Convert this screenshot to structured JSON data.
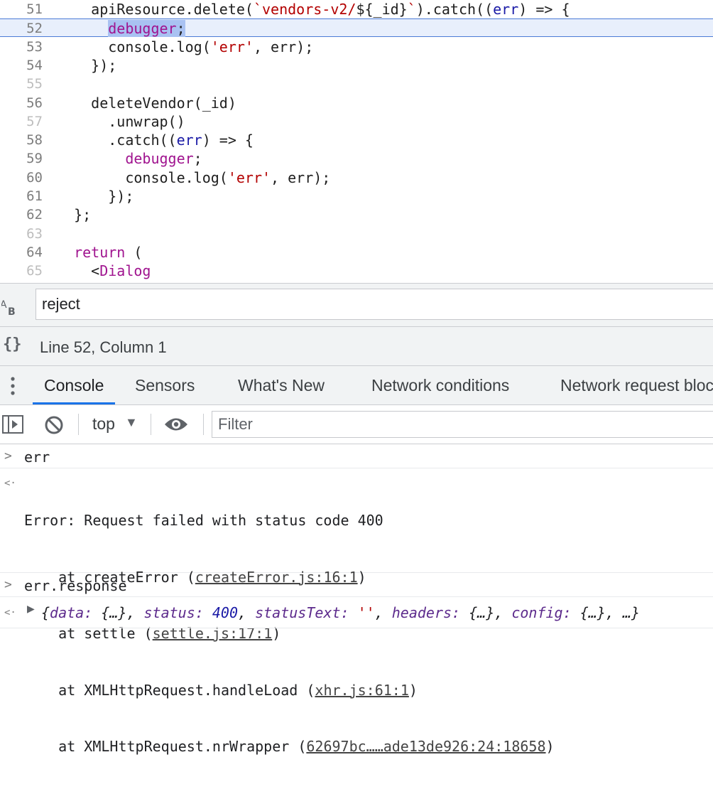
{
  "editor": {
    "lines": [
      {
        "num": "51",
        "tokens": [
          [
            "",
            "    apiResource.delete("
          ],
          [
            "str",
            "`vendors-v2/"
          ],
          [
            "",
            "${_id}"
          ],
          [
            "str",
            "`"
          ],
          [
            "",
            ").catch(("
          ],
          [
            "var",
            "err"
          ],
          [
            "",
            ") => {"
          ]
        ]
      },
      {
        "num": "52",
        "tokens": [
          [
            "",
            "      "
          ],
          [
            "kw sel",
            "debugger"
          ],
          [
            "sel",
            ";"
          ]
        ],
        "current": true
      },
      {
        "num": "53",
        "tokens": [
          [
            "",
            "      console.log("
          ],
          [
            "str",
            "'err'"
          ],
          [
            "",
            ", err);"
          ]
        ]
      },
      {
        "num": "54",
        "tokens": [
          [
            "",
            "    });"
          ]
        ]
      },
      {
        "num": "55",
        "tokens": [],
        "dim": true
      },
      {
        "num": "56",
        "tokens": [
          [
            "",
            "    deleteVendor(_id)"
          ]
        ]
      },
      {
        "num": "57",
        "tokens": [
          [
            "",
            "      .unwrap()"
          ]
        ],
        "dim": true
      },
      {
        "num": "58",
        "tokens": [
          [
            "",
            "      .catch(("
          ],
          [
            "var",
            "err"
          ],
          [
            "",
            ") => {"
          ]
        ]
      },
      {
        "num": "59",
        "tokens": [
          [
            "",
            "        "
          ],
          [
            "kw",
            "debugger"
          ],
          [
            "",
            ";"
          ]
        ]
      },
      {
        "num": "60",
        "tokens": [
          [
            "",
            "        console.log("
          ],
          [
            "str",
            "'err'"
          ],
          [
            "",
            ", err);"
          ]
        ]
      },
      {
        "num": "61",
        "tokens": [
          [
            "",
            "      });"
          ]
        ]
      },
      {
        "num": "62",
        "tokens": [
          [
            "",
            "  };"
          ]
        ]
      },
      {
        "num": "63",
        "tokens": [],
        "dim": true
      },
      {
        "num": "64",
        "tokens": [
          [
            "",
            "  "
          ],
          [
            "kw",
            "return"
          ],
          [
            "",
            " ("
          ]
        ]
      },
      {
        "num": "65",
        "tokens": [
          [
            "",
            "    <"
          ],
          [
            "kw",
            "Dialog"
          ]
        ],
        "dim": true
      }
    ]
  },
  "search": {
    "value": "reject",
    "icon": "regex-icon"
  },
  "status": {
    "position": "Line 52, Column 1",
    "icon": "pretty-print-icon"
  },
  "drawer": {
    "tabs": [
      {
        "label": "Console",
        "active": true
      },
      {
        "label": "Sensors"
      },
      {
        "label": "What's New"
      },
      {
        "label": "Network conditions"
      },
      {
        "label": "Network request blocking"
      }
    ]
  },
  "toolbar": {
    "context": "top",
    "context_arrow": "▼",
    "filter_placeholder": "Filter"
  },
  "console": {
    "input_prompt": ">",
    "output_prompt": "<·",
    "cmd1": "err",
    "error_message": "Error: Request failed with status code 400",
    "stack": [
      {
        "prefix": "    at createError (",
        "link": "createError.js:16:1",
        "suffix": ")"
      },
      {
        "prefix": "    at settle (",
        "link": "settle.js:17:1",
        "suffix": ")"
      },
      {
        "prefix": "    at XMLHttpRequest.handleLoad (",
        "link": "xhr.js:61:1",
        "suffix": ")"
      },
      {
        "prefix": "    at XMLHttpRequest.nrWrapper (",
        "link": "62697bc……ade13de926:24:18658",
        "suffix": ")"
      }
    ],
    "cmd2": "err.response",
    "object_preview": {
      "open": "{",
      "k_data": "data:",
      "v_data": " {…}, ",
      "k_status": "status:",
      "v_status": "400",
      "sep1": ", ",
      "k_statusText": "statusText:",
      "v_statusText": "''",
      "sep2": ", ",
      "k_headers": "headers:",
      "v_headers": " {…}, ",
      "k_config": "config:",
      "v_config": " {…}, …}"
    }
  }
}
